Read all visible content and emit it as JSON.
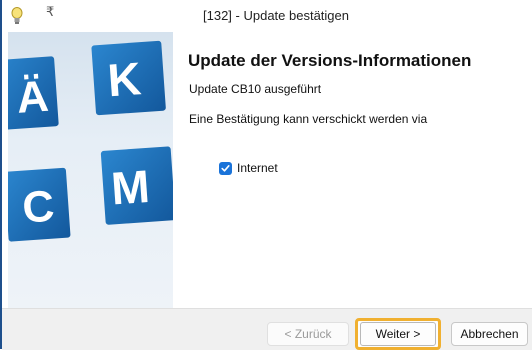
{
  "window": {
    "title": "[132] - Update bestätigen",
    "menu_glyph": "₹"
  },
  "sidebar": {
    "logo_letters": [
      "Ä",
      "K",
      "C",
      "M"
    ],
    "logo_color": "#1a6fb5"
  },
  "main": {
    "heading": "Update der Versions-Informationen",
    "line1": "Update CB10 ausgeführt",
    "line2": "Eine Bestätigung kann verschickt werden via",
    "checkbox": {
      "label": "Internet",
      "checked": true
    }
  },
  "footer": {
    "back_label": "< Zurück",
    "next_label": "Weiter >",
    "cancel_label": "Abbrechen",
    "highlight_color": "#f0b030"
  }
}
